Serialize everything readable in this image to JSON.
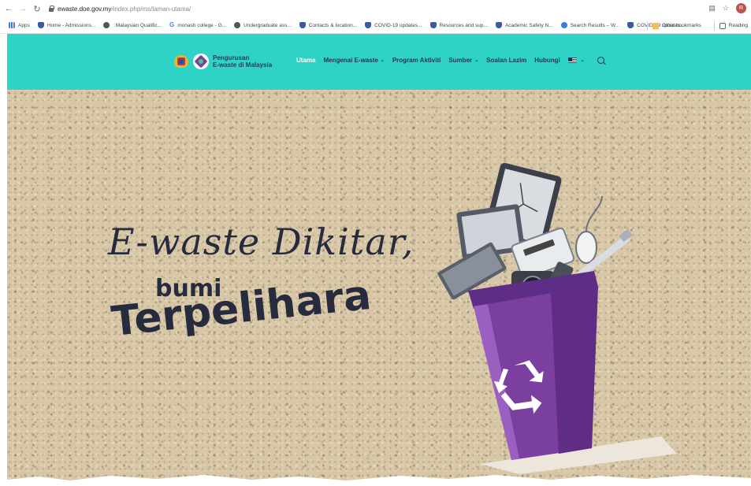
{
  "browser": {
    "url_host": "ewaste.doe.gov.my",
    "url_path": "/index.php/ms/laman-utama/",
    "avatar_letter": "R",
    "bookmarks": [
      {
        "label": "Apps",
        "icon": "apps"
      },
      {
        "label": "Home - Admissions...",
        "icon": "shield"
      },
      {
        "label": ": Malaysian Qualific...",
        "icon": "globe"
      },
      {
        "label": "monash college - G...",
        "icon": "g"
      },
      {
        "label": "Undergraduate ass...",
        "icon": "globe"
      },
      {
        "label": "Contacts & location...",
        "icon": "shield"
      },
      {
        "label": "COVID-19 updates...",
        "icon": "shield"
      },
      {
        "label": "Resources and sup...",
        "icon": "shield"
      },
      {
        "label": "Academic Safety N...",
        "icon": "shield"
      },
      {
        "label": "Search Results – W...",
        "icon": "globe"
      },
      {
        "label": "COVID-19 updates...",
        "icon": "shield"
      }
    ],
    "more_label": "»",
    "other_bookmarks": "Other bookmarks",
    "reading_list": "Reading"
  },
  "site": {
    "logo_line1": "Pengurusan",
    "logo_line2": "E-waste di Malaysia",
    "nav": [
      {
        "label": "Utama",
        "active": true,
        "dropdown": false
      },
      {
        "label": "Mengenai E-waste",
        "active": false,
        "dropdown": true
      },
      {
        "label": "Program Aktiviti",
        "active": false,
        "dropdown": false
      },
      {
        "label": "Sumber",
        "active": false,
        "dropdown": true
      },
      {
        "label": "Soalan Lazim",
        "active": false,
        "dropdown": false
      },
      {
        "label": "Hubungi",
        "active": false,
        "dropdown": false
      }
    ],
    "header_color": "#2fd3c6",
    "accent_text_color": "#1f3358"
  },
  "hero": {
    "headline": "E-waste Dikitar,",
    "line2": "bumi",
    "line3": "Terpelihara",
    "bin_color": "#7b3fa0"
  }
}
